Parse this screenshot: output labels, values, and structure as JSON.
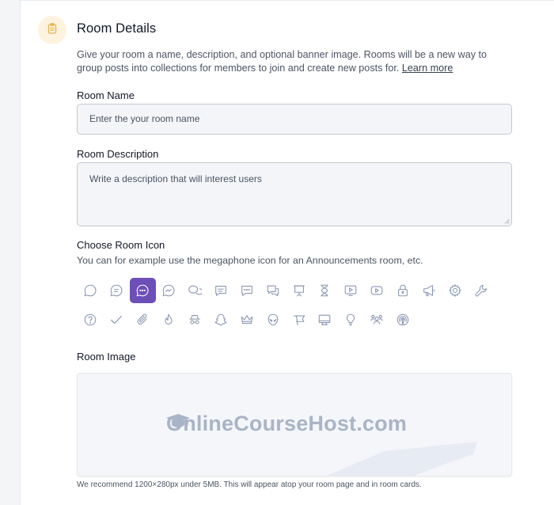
{
  "header": {
    "title": "Room Details",
    "description": "Give your room a name, description, and optional banner image. Rooms will be a new way to group posts into collections for members to join and create new posts for.",
    "learn_more": "Learn more",
    "icon": "clipboard-icon"
  },
  "room_name": {
    "label": "Room Name",
    "placeholder": "Enter the your room name"
  },
  "room_description": {
    "label": "Room Description",
    "placeholder": "Write a description that will interest users"
  },
  "room_icon": {
    "label": "Choose Room Icon",
    "sub": "You can for example use the megaphone icon for an Announcements room, etc.",
    "selected": "message-dots-icon",
    "row1": [
      "chat-bubble-icon",
      "chat-lines-icon",
      "message-dots-icon",
      "messenger-icon",
      "chats-icon",
      "comment-lines-icon",
      "comment-dots-icon",
      "conversation-icon",
      "presentation-icon",
      "hourglass-icon",
      "video-play-icon",
      "youtube-icon",
      "lock-icon",
      "megaphone-icon",
      "gear-icon",
      "wrench-icon"
    ],
    "row2": [
      "question-icon",
      "check-icon",
      "paperclip-icon",
      "flame-icon",
      "spy-icon",
      "snapchat-icon",
      "crown-icon",
      "alien-icon",
      "flag-icon",
      "monitor-icon",
      "lightbulb-icon",
      "users-icon",
      "podcast-icon"
    ]
  },
  "room_image": {
    "label": "Room Image",
    "logo_text": "OnlineCourseHost.com",
    "hint": "We recommend 1200×280px under 5MB. This will appear atop your room page and in room cards."
  },
  "colors": {
    "accent": "#6d4fb8",
    "icon": "#8a98b4",
    "header_icon_bg": "#fdf3df",
    "header_icon": "#e6b44a"
  }
}
